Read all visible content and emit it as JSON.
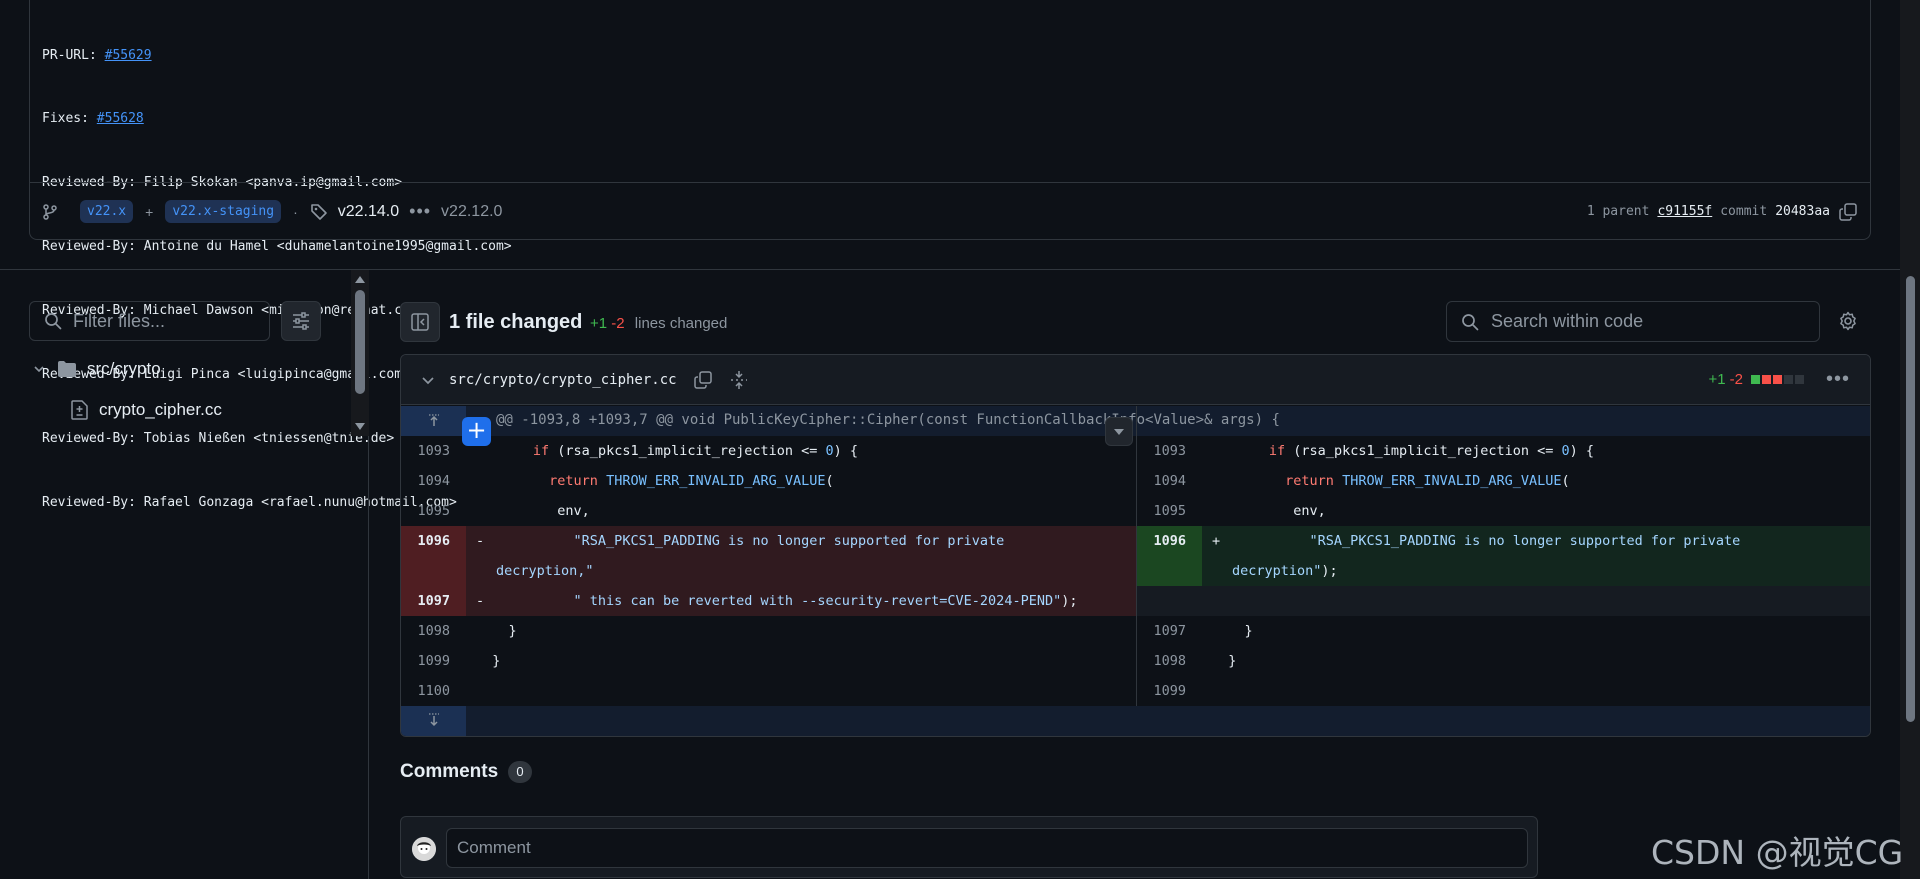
{
  "commit": {
    "message_lines": [
      {
        "label": "PR-URL: ",
        "link": "#55629"
      },
      {
        "label": "Fixes: ",
        "link": "#55628"
      },
      {
        "label": "Reviewed-By: Filip Skokan <panva.ip@gmail.com>"
      },
      {
        "label": "Reviewed-By: Antoine du Hamel <duhamelantoine1995@gmail.com>"
      },
      {
        "label": "Reviewed-By: Michael Dawson <midawson@redhat.com>"
      },
      {
        "label": "Reviewed-By: Luigi Pinca <luigipinca@gmail.com>"
      },
      {
        "label": "Reviewed-By: Tobias Nießen <tniessen@tnie.de>"
      },
      {
        "label": "Reviewed-By: Rafael Gonzaga <rafael.nunu@hotmail.com>"
      }
    ],
    "branches": [
      "v22.x",
      "v22.x-staging"
    ],
    "branch_plus": "+",
    "dot_sep": "·",
    "tag": "v22.14.0",
    "tag_dots": "•••",
    "tag_prev": "v22.12.0",
    "parent_label": "1 parent",
    "parent_sha": "c91155f",
    "commit_label": "commit",
    "commit_sha": "20483aa"
  },
  "file_tree": {
    "filter_placeholder": "Filter files...",
    "folder": "src/crypto",
    "file": "crypto_cipher.cc"
  },
  "diff_summary": {
    "files_changed": "1 file changed",
    "additions": "+1",
    "deletions": "-2",
    "lines_changed_label": "lines changed",
    "search_placeholder": "Search within code"
  },
  "diff_file": {
    "path": "src/crypto/crypto_cipher.cc",
    "additions": "+1",
    "deletions": "-2",
    "stat_colors": [
      "#3fb950",
      "#f85149",
      "#f85149",
      "#30363d",
      "#30363d"
    ],
    "hunk_header": "@@ -1093,8 +1093,7 @@ void PublicKeyCipher::Cipher(const FunctionCallbackInfo<Value>& args) {",
    "left": [
      {
        "ln": "1093",
        "type": "ctx"
      },
      {
        "ln": "1094",
        "type": "ctx"
      },
      {
        "ln": "1095",
        "type": "ctx",
        "text": "          env,"
      },
      {
        "ln": "1096",
        "type": "del"
      },
      {
        "ln": "1097",
        "type": "del"
      },
      {
        "ln": "1098",
        "type": "ctx",
        "text": "    }"
      },
      {
        "ln": "1099",
        "type": "ctx",
        "text": "  }"
      },
      {
        "ln": "1100",
        "type": "ctx",
        "text": ""
      }
    ],
    "right": [
      {
        "ln": "1093",
        "type": "ctx"
      },
      {
        "ln": "1094",
        "type": "ctx"
      },
      {
        "ln": "1095",
        "type": "ctx",
        "text": "          env,"
      },
      {
        "ln": "1096",
        "type": "add"
      },
      {
        "ln": "",
        "type": "empty"
      },
      {
        "ln": "1097",
        "type": "ctx",
        "text": "    }"
      },
      {
        "ln": "1098",
        "type": "ctx",
        "text": "  }"
      },
      {
        "ln": "1099",
        "type": "ctx",
        "text": ""
      }
    ],
    "code": {
      "if_kw": "if",
      "if_rest_a": " (rsa_pkcs1_implicit_rejection <= ",
      "zero": "0",
      "if_rest_b": ") {",
      "return_kw": "return",
      "throw_fn": "THROW_ERR_INVALID_ARG_VALUE",
      "paren": "(",
      "del_marker": "-",
      "add_marker": "+",
      "str_main": "\"RSA_PKCS1_PADDING is no longer supported for private",
      "str_wrap_left": "decryption,\"",
      "str_wrap_right": "decryption\"",
      "str_wrap_right_tail": ");",
      "str_revert": "\" this can be reverted with --security-revert=CVE-2024-PEND\"",
      "str_revert_tail": ");"
    }
  },
  "comments": {
    "title": "Comments",
    "count": "0",
    "placeholder": "Comment"
  },
  "watermark": "CSDN @视觉CG"
}
